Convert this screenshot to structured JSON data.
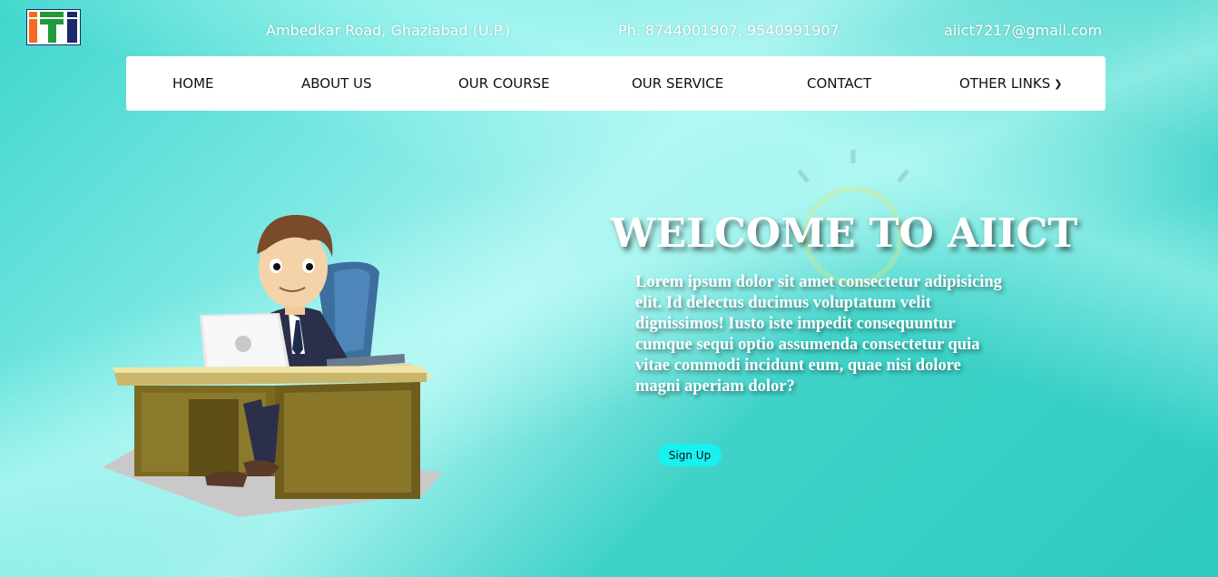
{
  "header": {
    "address": "Ambedkar Road, Ghaziabad (U.P.)",
    "phone": "Ph. 8744001907, 9540991907",
    "email": "aiict7217@gmail.com"
  },
  "nav": {
    "items": [
      {
        "label": "HOME"
      },
      {
        "label": "ABOUT US"
      },
      {
        "label": "OUR COURSE"
      },
      {
        "label": "OUR SERVICE"
      },
      {
        "label": "CONTACT"
      },
      {
        "label": "OTHER LINKS"
      }
    ],
    "dropdown_icon": "chevron-down-icon"
  },
  "hero": {
    "title": "WELCOME TO AIICT",
    "body": "Lorem ipsum dolor sit amet consectetur adipisicing elit. Id delectus ducimus voluptatum velit dignissimos! Iusto iste impedit consequuntur cumque sequi optio assumenda consectetur quia vitae commodi incidunt eum, quae nisi dolore magni aperiam dolor?",
    "signup_label": "Sign Up"
  },
  "colors": {
    "background": "#2ecdc5",
    "signup_button": "#19f0f0",
    "nav_background": "#ffffff"
  }
}
